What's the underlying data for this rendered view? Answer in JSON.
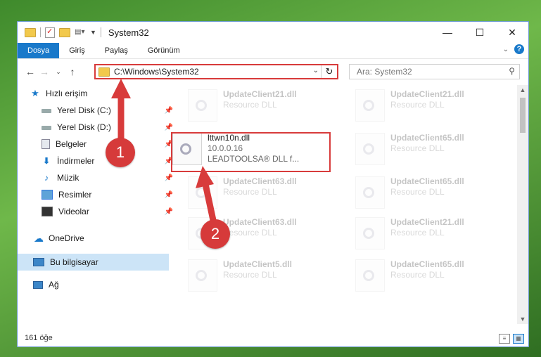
{
  "window": {
    "title": "System32",
    "controls": {
      "minimize": "—",
      "maximize": "☐",
      "close": "✕"
    }
  },
  "ribbon": {
    "tabs": [
      "Dosya",
      "Giriş",
      "Paylaş",
      "Görünüm"
    ],
    "active_tab": "Dosya"
  },
  "address": {
    "path": "C:\\Windows\\System32",
    "search_placeholder": "Ara: System32"
  },
  "sidebar": {
    "quick_access": "Hızlı erişim",
    "items": [
      {
        "label": "Yerel Disk (C:)",
        "icon": "drive-icon",
        "pinned": true
      },
      {
        "label": "Yerel Disk (D:)",
        "icon": "drive-icon",
        "pinned": true
      },
      {
        "label": "Belgeler",
        "icon": "documents-icon",
        "pinned": true
      },
      {
        "label": "İndirmeler",
        "icon": "downloads-icon",
        "pinned": true
      },
      {
        "label": "Müzik",
        "icon": "music-icon",
        "pinned": true
      },
      {
        "label": "Resimler",
        "icon": "pictures-icon",
        "pinned": true
      },
      {
        "label": "Videolar",
        "icon": "videos-icon",
        "pinned": true
      }
    ],
    "onedrive": "OneDrive",
    "this_pc": "Bu bilgisayar",
    "network": "Ağ"
  },
  "files": {
    "selected": {
      "name": "lttwn10n.dll",
      "version": "10.0.0.16",
      "description": "LEADTOOLSA® DLL f..."
    },
    "ghosts": [
      {
        "name": "UpdateClient21.dll",
        "type": "Resource DLL"
      },
      {
        "name": "UpdateClient21.dll",
        "type": "Resource DLL"
      },
      {
        "name": "UpdateClient65.dll",
        "type": "Resource DLL"
      },
      {
        "name": "UpdateClient63.dll",
        "type": "Resource DLL"
      },
      {
        "name": "UpdateClient65.dll",
        "type": "Resource DLL"
      },
      {
        "name": "UpdateClient63.dll",
        "type": "Resource DLL"
      },
      {
        "name": "UpdateClient21.dll",
        "type": "Resource DLL"
      },
      {
        "name": "UpdateClient5.dll",
        "type": "Resource DLL"
      },
      {
        "name": "UpdateClient65.dll",
        "type": "Resource DLL"
      }
    ]
  },
  "status": {
    "count": "161 öğe"
  },
  "annotations": {
    "step1": "1",
    "step2": "2",
    "color": "#d83b3b"
  }
}
